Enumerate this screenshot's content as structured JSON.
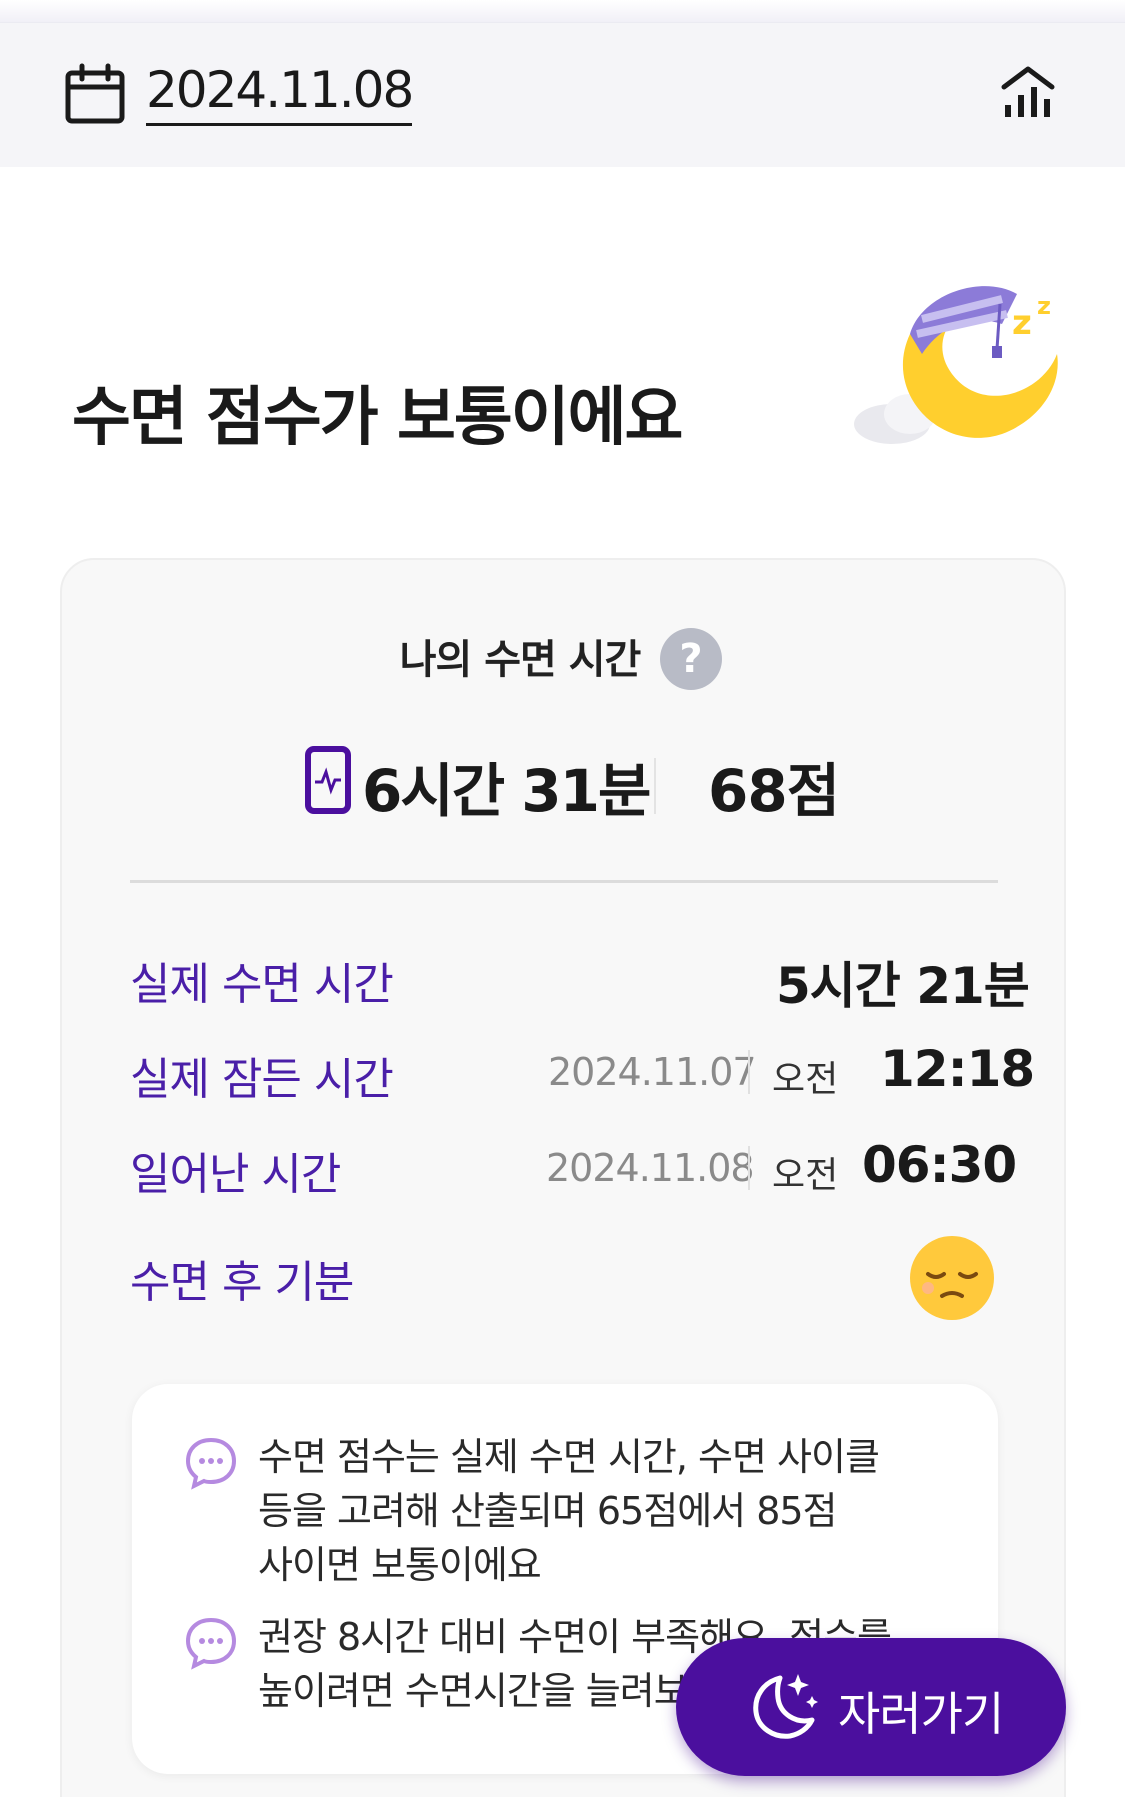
{
  "header": {
    "date": "2024.11.08",
    "calendar_icon": "calendar-icon",
    "stats_icon": "bar-chart-icon"
  },
  "title": "수면 점수가 보통이에요",
  "card": {
    "heading": "나의 수면 시간",
    "help_icon": "?",
    "total_time": "6시간 31분",
    "score": "68점",
    "rows": [
      {
        "label": "실제 수면 시간",
        "value": "5시간 21분"
      },
      {
        "label": "실제 잠든 시간",
        "date": "2024.11.07",
        "ampm": "오전",
        "time": "12:18"
      },
      {
        "label": "일어난 시간",
        "date": "2024.11.08",
        "ampm": "오전",
        "time": "06:30"
      },
      {
        "label": "수면 후 기분",
        "mood_icon": "sleepy-face-icon"
      }
    ],
    "info": [
      {
        "line1": "수면 점수는 실제 수면 시간, 수면 사이클",
        "line2": "등을 고려해 산출되며 65점에서 85점",
        "line3": "사이면 보통이에요"
      },
      {
        "line1": "권장 8시간 대비 수면이 부족해요. 점수를",
        "line2": "높이려면 수면시간을 늘려보세요"
      }
    ]
  },
  "sleep_button": {
    "label": "자러가기",
    "icon": "moon-sparkle-icon"
  },
  "colors": {
    "accent": "#4b0f9e",
    "label_purple": "#4a1fa8",
    "header_bg": "#f5f5f8"
  }
}
